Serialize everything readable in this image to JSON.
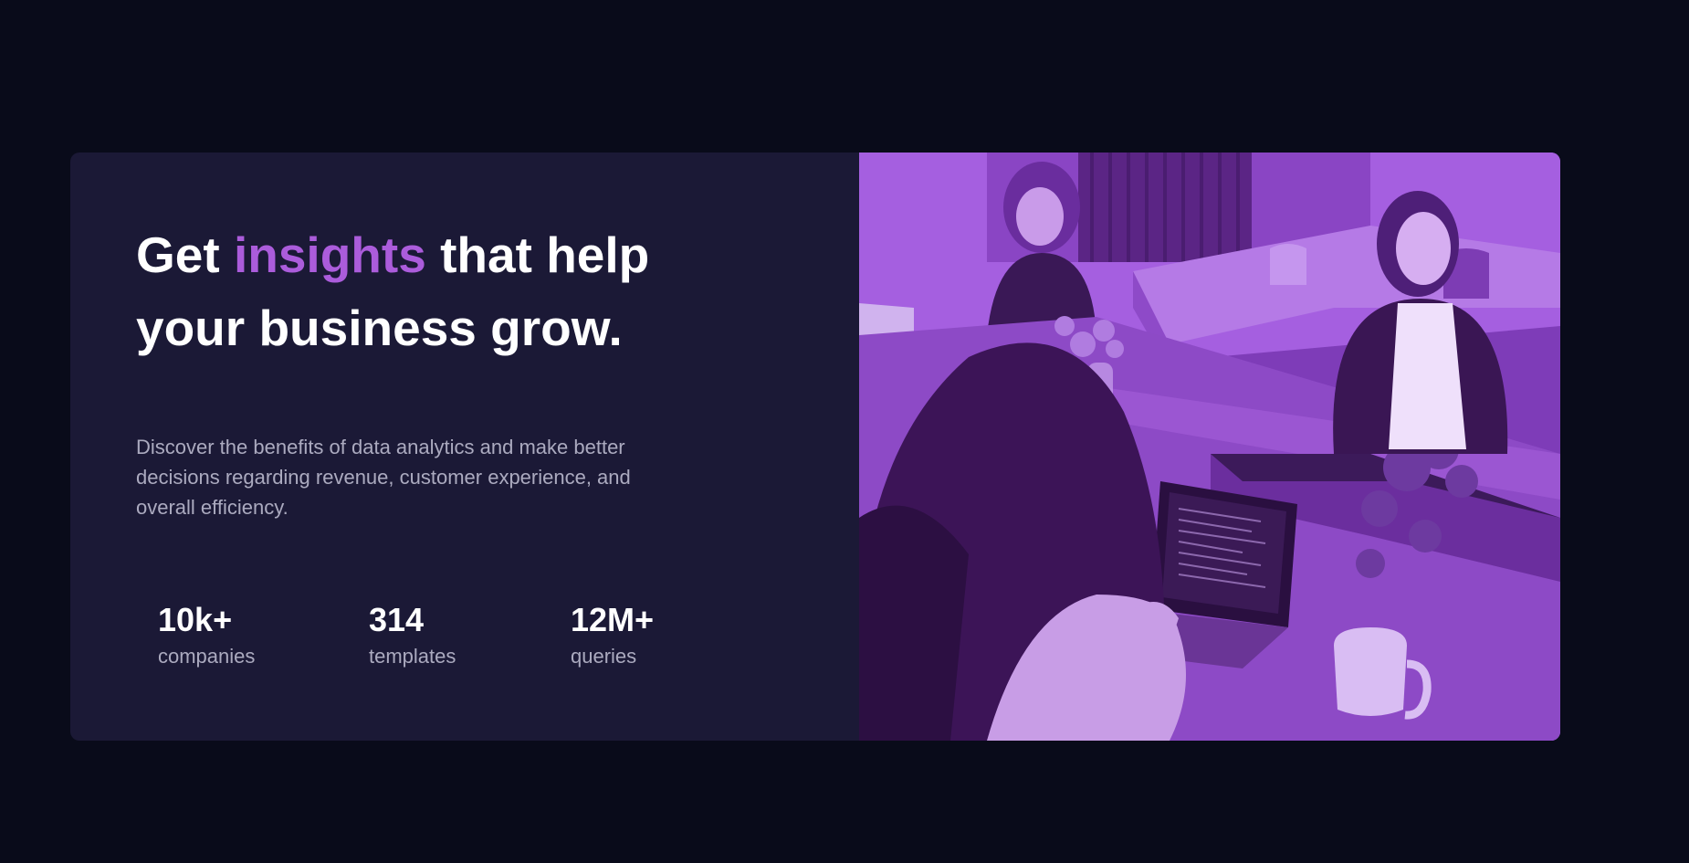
{
  "hero": {
    "heading": {
      "before": "Get",
      "accent": "insights",
      "after": "that help your business grow."
    },
    "description": "Discover the benefits of data analytics and make better decisions regarding revenue, customer experience, and overall efficiency.",
    "stats": [
      {
        "value": "10k+",
        "label": "companies"
      },
      {
        "value": "314",
        "label": "templates"
      },
      {
        "value": "12M+",
        "label": "queries"
      }
    ],
    "image": {
      "subject": "team-working-at-office-table-photo",
      "tint_color": "#a15bdc"
    }
  },
  "colors": {
    "page_background": "#090b1a",
    "card_background": "#1b1936",
    "accent": "#ab5cdb",
    "heading_text": "#ffffff",
    "body_text": "#c5c4d8"
  }
}
